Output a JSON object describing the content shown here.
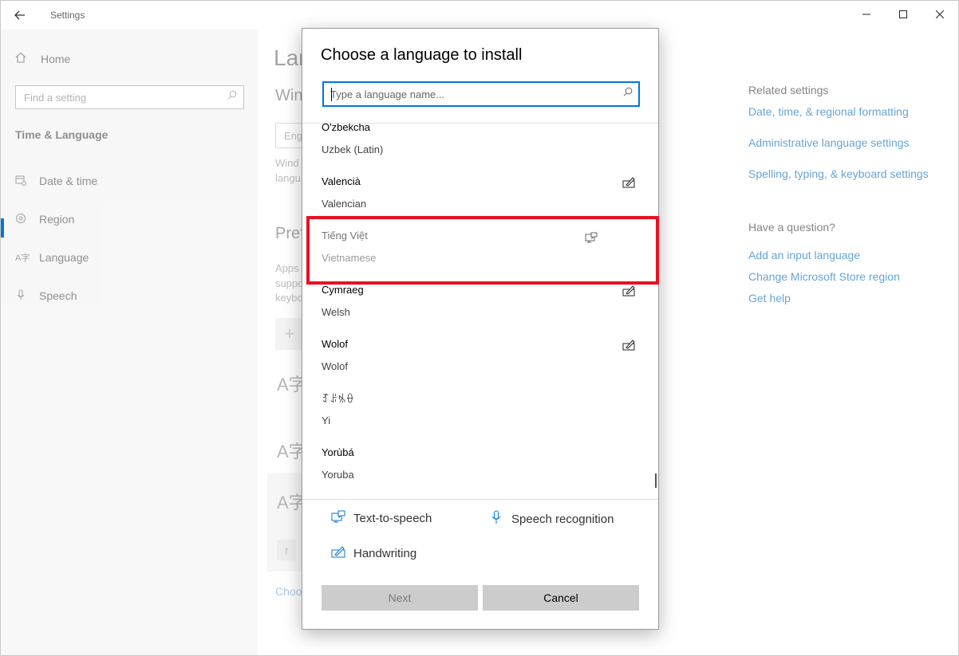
{
  "window": {
    "app_title": "Settings",
    "controls": {
      "minimize": "—",
      "maximize": "☐",
      "close": "✕"
    }
  },
  "sidebar": {
    "home_label": "Home",
    "search_placeholder": "Find a setting",
    "section_title": "Time & Language",
    "items": [
      {
        "label": "Date & time",
        "icon": "calendar-clock-icon",
        "glyph": "⊞"
      },
      {
        "label": "Region",
        "icon": "globe-icon",
        "glyph": "◎"
      },
      {
        "label": "Language",
        "icon": "language-icon",
        "glyph": "A字",
        "active": true
      },
      {
        "label": "Speech",
        "icon": "microphone-icon",
        "glyph": "🎙"
      }
    ]
  },
  "background_content": {
    "title": "Lan",
    "subtitle": "Win",
    "box_text": "Eng",
    "text1": "Wind",
    "text2": "langu",
    "subtitle2": "Pref",
    "text3": "Apps",
    "text4": "suppo",
    "text5": "keybo",
    "link": "Choo"
  },
  "related": {
    "heading": "Related settings",
    "links": [
      "Date, time, & regional formatting",
      "Administrative language settings",
      "Spelling, typing, & keyboard settings"
    ],
    "question_heading": "Have a question?",
    "question_links": [
      "Add an input language",
      "Change Microsoft Store region",
      "Get help"
    ]
  },
  "dialog": {
    "title": "Choose a language to install",
    "search_placeholder": "Type a language name...",
    "languages": [
      {
        "native": "O'zbekcha",
        "english": "Uzbek (Latin)",
        "features": []
      },
      {
        "native": "Valencià",
        "english": "Valencian",
        "features": [
          "handwriting"
        ]
      },
      {
        "native": "Tiếng Việt",
        "english": "Vietnamese",
        "features": [
          "text-to-speech"
        ],
        "disabled": true
      },
      {
        "native": "Cymraeg",
        "english": "Welsh",
        "features": [
          "handwriting"
        ]
      },
      {
        "native": "Wolof",
        "english": "Wolof",
        "features": [
          "handwriting"
        ]
      },
      {
        "native": "ꆈꌠꁱꂷ",
        "english": "Yi",
        "features": []
      },
      {
        "native": "Yorùbá",
        "english": "Yoruba",
        "features": []
      }
    ],
    "legend": {
      "tts": "Text-to-speech",
      "speech": "Speech recognition",
      "handwriting": "Handwriting"
    },
    "buttons": {
      "next": "Next",
      "cancel": "Cancel"
    }
  },
  "colors": {
    "accent": "#0078d7",
    "link": "#0067b8",
    "highlight": "#e81123"
  }
}
